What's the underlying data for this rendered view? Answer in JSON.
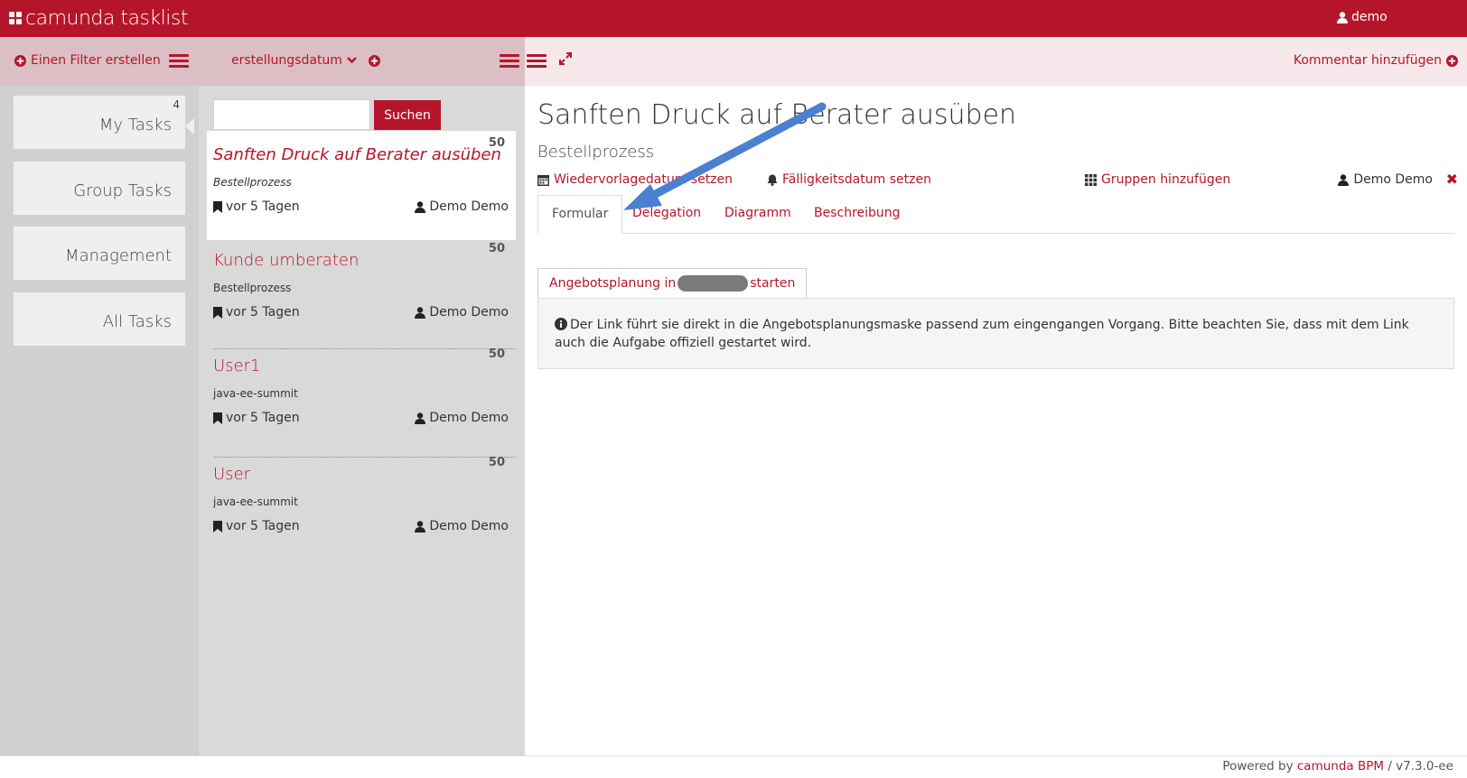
{
  "app": {
    "brand_text": "camunda tasklist",
    "accent_color": "#b5152b"
  },
  "header": {
    "user_label": "demo"
  },
  "filters": {
    "create_label": "Einen Filter erstellen",
    "items": [
      {
        "label": "My Tasks",
        "count": "4"
      },
      {
        "label": "Group Tasks"
      },
      {
        "label": "Management"
      },
      {
        "label": "All Tasks"
      }
    ]
  },
  "tasklist": {
    "sort_label": "erstellungsdatum",
    "search": {
      "value": "",
      "button_label": "Suchen"
    },
    "tasks": [
      {
        "name": "Sanften Druck auf Berater ausüben",
        "process": "Bestellprozess",
        "created": "vor 5 Tagen",
        "assignee": "Demo Demo",
        "priority": "50"
      },
      {
        "name": "Kunde umberaten",
        "process": "Bestellprozess",
        "created": "vor 5 Tagen",
        "assignee": "Demo Demo",
        "priority": "50"
      },
      {
        "name": "User1",
        "process": "java-ee-summit",
        "created": "vor 5 Tagen",
        "assignee": "Demo Demo",
        "priority": "50"
      },
      {
        "name": "User",
        "process": "java-ee-summit",
        "created": "vor 5 Tagen",
        "assignee": "Demo Demo",
        "priority": "50"
      }
    ]
  },
  "detail": {
    "add_comment_label": "Kommentar hinzufügen",
    "title": "Sanften Druck auf Berater ausüben",
    "process": "Bestellprozess",
    "followup_label": "Wiedervorlagedatum setzen",
    "due_label": "Fälligkeitsdatum setzen",
    "groups_label": "Gruppen hinzufügen",
    "assignee": "Demo Demo",
    "tabs": [
      {
        "label": "Formular"
      },
      {
        "label": "Delegation"
      },
      {
        "label": "Diagramm"
      },
      {
        "label": "Beschreibung"
      }
    ],
    "form": {
      "button_prefix": "Angebotsplanung in",
      "button_suffix": "starten",
      "info_text": "Der Link führt sie direkt in die Angebotsplanungsmaske passend zum eingengangen Vorgang. Bitte beachten Sie, dass mit dem Link auch die Aufgabe offiziell gestartet wird."
    }
  },
  "footer": {
    "prefix": "Powered by",
    "link": "camunda BPM",
    "version": "/ v7.3.0-ee"
  },
  "annotation": {
    "arrow_color": "#4a7fd1"
  }
}
